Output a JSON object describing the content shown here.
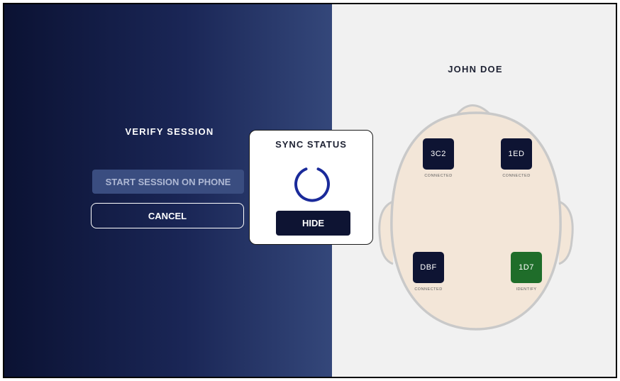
{
  "verify_session": {
    "title": "VERIFY SESSION",
    "start_button": "START SESSION ON PHONE",
    "cancel_button": "CANCEL"
  },
  "sync_modal": {
    "title": "SYNC STATUS",
    "hide_button": "HIDE"
  },
  "patient": {
    "name": "JOHN DOE"
  },
  "sensors": [
    {
      "id": "3C2",
      "status": "CONNECTED",
      "color": "#0e1433"
    },
    {
      "id": "1ED",
      "status": "CONNECTED",
      "color": "#0e1433"
    },
    {
      "id": "DBF",
      "status": "CONNECTED",
      "color": "#0e1433"
    },
    {
      "id": "1D7",
      "status": "IDENTIFY",
      "color": "#1f6d2a"
    }
  ],
  "colors": {
    "navy": "#0e1433",
    "spinner": "#1a2a9a",
    "head_fill": "#f3e6d8",
    "head_outline": "#c9c9c9"
  }
}
